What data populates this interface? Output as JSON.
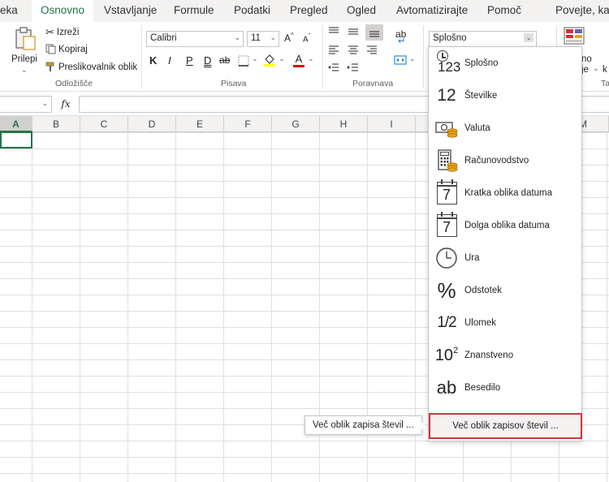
{
  "tabs": [
    {
      "label": "eka",
      "active": false
    },
    {
      "label": "Osnovno",
      "active": true
    },
    {
      "label": "Vstavljanje",
      "active": false
    },
    {
      "label": "Formule",
      "active": false
    },
    {
      "label": "Podatki",
      "active": false
    },
    {
      "label": "Pregled",
      "active": false
    },
    {
      "label": "Ogled",
      "active": false
    },
    {
      "label": "Avtomatizirajte",
      "active": false
    },
    {
      "label": "Pomoč",
      "active": false
    },
    {
      "label": "Povejte, kaj",
      "active": false
    }
  ],
  "clipboard": {
    "paste_label": "Prilepi",
    "cut_label": "Izreži",
    "copy_label": "Kopiraj",
    "painter_label": "Preslikovalnik oblik",
    "group_label": "Odložišče"
  },
  "font": {
    "family": "Calibri",
    "size": "11",
    "grow_label": "A",
    "shrink_label": "A",
    "bold": "K",
    "italic": "I",
    "underline": "P",
    "double_underline": "D",
    "strike": "ab",
    "font_color_letter": "A",
    "group_label": "Pisava"
  },
  "alignment": {
    "wrap_label": "ab",
    "group_label": "Poravnava"
  },
  "number": {
    "current_format": "Splošno"
  },
  "partial_right": {
    "line1": "no",
    "line2": "je",
    "line3": "Ta",
    "line4": "k"
  },
  "formula_bar": {
    "fx": "fx"
  },
  "columns": [
    "A",
    "B",
    "C",
    "D",
    "E",
    "F",
    "G",
    "H",
    "I",
    "M"
  ],
  "dropdown": {
    "items": [
      {
        "label": "Splošno",
        "icon": "general-123-icon",
        "glyph": "123"
      },
      {
        "label": "Številke",
        "icon": "number-12-icon",
        "glyph": "12"
      },
      {
        "label": "Valuta",
        "icon": "currency-icon"
      },
      {
        "label": "Računovodstvo",
        "icon": "accounting-icon"
      },
      {
        "label": "Kratka oblika datuma",
        "icon": "short-date-calendar-icon",
        "glyph": "7"
      },
      {
        "label": "Dolga oblika datuma",
        "icon": "long-date-calendar-icon",
        "glyph": "7"
      },
      {
        "label": "Ura",
        "icon": "clock-icon"
      },
      {
        "label": "Odstotek",
        "icon": "percent-icon",
        "glyph": "%"
      },
      {
        "label": "Ulomek",
        "icon": "fraction-icon",
        "glyph": "1/2"
      },
      {
        "label": "Znanstveno",
        "icon": "scientific-icon",
        "glyph": "10",
        "sup": "2"
      },
      {
        "label": "Besedilo",
        "icon": "text-ab-icon",
        "glyph": "ab"
      }
    ],
    "more_label": "Več oblik zapisov števil ...",
    "tooltip": "Več oblik zapisa števil ..."
  },
  "colors": {
    "accent": "#217346",
    "highlight_border": "#d13438",
    "coin": "#e8a317"
  }
}
